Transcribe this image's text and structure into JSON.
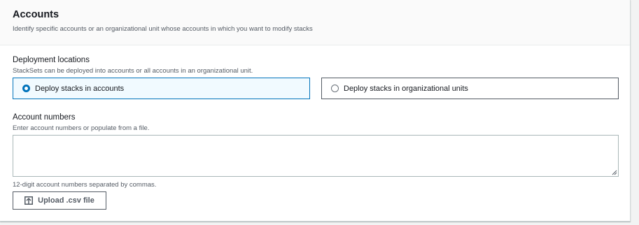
{
  "section": {
    "title": "Accounts",
    "description": "Identify specific accounts or an organizational unit whose accounts in which you want to modify stacks"
  },
  "deployment_locations": {
    "label": "Deployment locations",
    "description": "StackSets can be deployed into accounts or all accounts in an organizational unit.",
    "options": [
      {
        "label": "Deploy stacks in accounts",
        "selected": true
      },
      {
        "label": "Deploy stacks in organizational units",
        "selected": false
      }
    ]
  },
  "account_numbers": {
    "label": "Account numbers",
    "description": "Enter account numbers or populate from a file.",
    "value": "",
    "constraint": "12-digit account numbers separated by commas."
  },
  "upload": {
    "label": "Upload .csv file",
    "icon": "upload-icon"
  },
  "colors": {
    "accent": "#0073bb",
    "selected_bg": "#f1faff",
    "text": "#16191f",
    "secondary_text": "#545b64"
  }
}
